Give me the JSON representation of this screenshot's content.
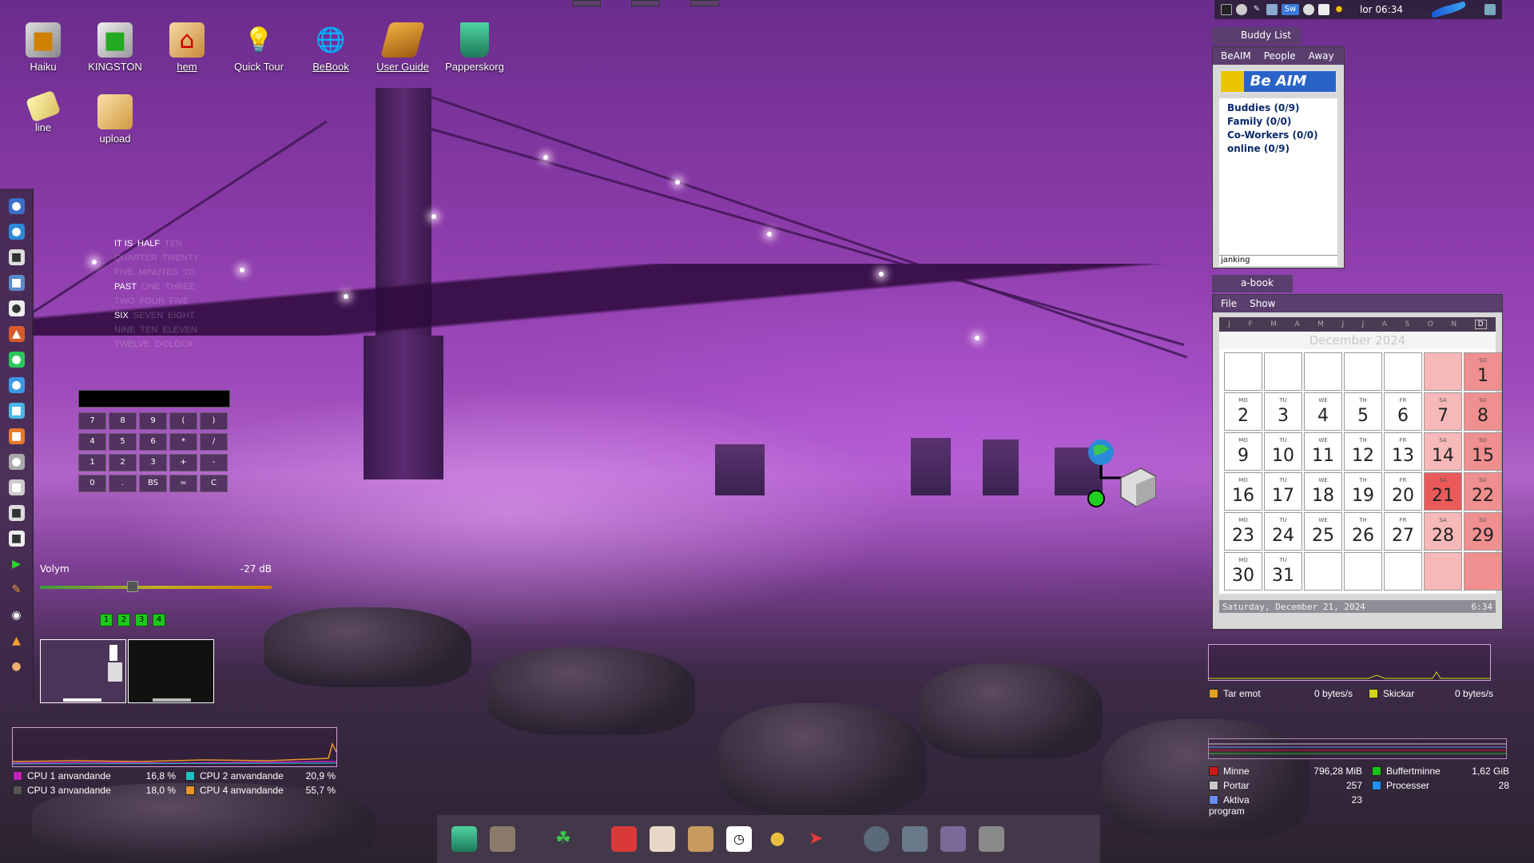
{
  "desktop_icons": [
    {
      "label": "Haiku",
      "icon": "haiku-drive-icon"
    },
    {
      "label": "KINGSTON",
      "icon": "usb-drive-icon"
    },
    {
      "label": "hem",
      "icon": "home-folder-icon"
    },
    {
      "label": "Quick Tour",
      "icon": "lightbulb-icon"
    },
    {
      "label": "BeBook",
      "icon": "globe-book-icon"
    },
    {
      "label": "User Guide",
      "icon": "book-icon"
    },
    {
      "label": "Papperskorg",
      "icon": "trash-icon"
    },
    {
      "label": "line",
      "icon": "document-icon"
    },
    {
      "label": "upload",
      "icon": "folder-icon"
    }
  ],
  "word_clock": {
    "rows": [
      [
        {
          "w": "IT IS",
          "on": true
        },
        {
          "w": "HALF",
          "on": true
        },
        {
          "w": "TEN",
          "on": false
        }
      ],
      [
        {
          "w": "QUARTER",
          "on": false
        },
        {
          "w": "TWENTY",
          "on": false
        }
      ],
      [
        {
          "w": "FIVE",
          "on": false
        },
        {
          "w": "MINUTES",
          "on": false
        },
        {
          "w": "TO",
          "on": false
        }
      ],
      [
        {
          "w": "PAST",
          "on": true
        },
        {
          "w": "ONE",
          "on": false
        },
        {
          "w": "THREE",
          "on": false
        }
      ],
      [
        {
          "w": "TWO",
          "on": false
        },
        {
          "w": "FOUR",
          "on": false
        },
        {
          "w": "FIVE",
          "on": false
        }
      ],
      [
        {
          "w": "SIX",
          "on": true
        },
        {
          "w": "SEVEN",
          "on": false
        },
        {
          "w": "EIGHT",
          "on": false
        }
      ],
      [
        {
          "w": "NINE",
          "on": false
        },
        {
          "w": "TEN",
          "on": false
        },
        {
          "w": "ELEVEN",
          "on": false
        }
      ],
      [
        {
          "w": "TWELVE",
          "on": false
        },
        {
          "w": "O'CLOCK",
          "on": false
        }
      ]
    ]
  },
  "calculator": {
    "display": "",
    "keys": [
      "7",
      "8",
      "9",
      "(",
      ")",
      "4",
      "5",
      "6",
      "*",
      "/",
      "1",
      "2",
      "3",
      "+",
      "-",
      "0",
      ".",
      "BS",
      "=",
      "C"
    ]
  },
  "volume": {
    "label": "Volym",
    "value": "-27 dB",
    "level": 0.4
  },
  "workspaces": [
    "1",
    "2",
    "3",
    "4"
  ],
  "cpu": {
    "items": [
      {
        "label": "CPU 1 anvandande",
        "value": "16,8 %",
        "color": "#c21fc2"
      },
      {
        "label": "CPU 2 anvandande",
        "value": "20,9 %",
        "color": "#1fc2c2"
      },
      {
        "label": "CPU 3 anvandande",
        "value": "18,0 %",
        "color": "#555555"
      },
      {
        "label": "CPU 4 anvandande",
        "value": "55,7 %",
        "color": "#e8962a"
      }
    ]
  },
  "topbar": {
    "clock": "lor 06:34",
    "sw_label": "Sw"
  },
  "buddy_list": {
    "title": "Buddy List",
    "menu": [
      "BeAIM",
      "People",
      "Away"
    ],
    "banner": "Be AIM",
    "groups": [
      "Buddies (0/9)",
      "Family (0/0)",
      "Co-Workers (0/0)",
      "online (0/9)"
    ],
    "status": "janking"
  },
  "abook": {
    "title": "a-book",
    "menu": [
      "File",
      "Show"
    ],
    "months": [
      "J",
      "F",
      "M",
      "A",
      "M",
      "J",
      "J",
      "A",
      "S",
      "O",
      "N",
      "D"
    ],
    "month_title": "December 2024",
    "weeks": [
      [
        {
          "d": "",
          "n": ""
        },
        {
          "d": "",
          "n": ""
        },
        {
          "d": "",
          "n": ""
        },
        {
          "d": "",
          "n": ""
        },
        {
          "d": "",
          "n": ""
        },
        {
          "d": "",
          "n": "",
          "t": "sat"
        },
        {
          "d": "SU",
          "n": "1",
          "t": "sun"
        }
      ],
      [
        {
          "d": "MO",
          "n": "2"
        },
        {
          "d": "TU",
          "n": "3"
        },
        {
          "d": "WE",
          "n": "4"
        },
        {
          "d": "TH",
          "n": "5"
        },
        {
          "d": "FR",
          "n": "6"
        },
        {
          "d": "SA",
          "n": "7",
          "t": "sat"
        },
        {
          "d": "SU",
          "n": "8",
          "t": "sun"
        }
      ],
      [
        {
          "d": "MO",
          "n": "9"
        },
        {
          "d": "TU",
          "n": "10"
        },
        {
          "d": "WE",
          "n": "11"
        },
        {
          "d": "TH",
          "n": "12"
        },
        {
          "d": "FR",
          "n": "13"
        },
        {
          "d": "SA",
          "n": "14",
          "t": "sat"
        },
        {
          "d": "SU",
          "n": "15",
          "t": "sun"
        }
      ],
      [
        {
          "d": "MO",
          "n": "16"
        },
        {
          "d": "TU",
          "n": "17"
        },
        {
          "d": "WE",
          "n": "18"
        },
        {
          "d": "TH",
          "n": "19"
        },
        {
          "d": "FR",
          "n": "20"
        },
        {
          "d": "SA",
          "n": "21",
          "t": "today"
        },
        {
          "d": "SU",
          "n": "22",
          "t": "sun"
        }
      ],
      [
        {
          "d": "MO",
          "n": "23"
        },
        {
          "d": "TU",
          "n": "24"
        },
        {
          "d": "WE",
          "n": "25"
        },
        {
          "d": "TH",
          "n": "26"
        },
        {
          "d": "FR",
          "n": "27"
        },
        {
          "d": "SA",
          "n": "28",
          "t": "sat"
        },
        {
          "d": "SU",
          "n": "29",
          "t": "sun"
        }
      ],
      [
        {
          "d": "MO",
          "n": "30"
        },
        {
          "d": "TU",
          "n": "31"
        },
        {
          "d": "",
          "n": ""
        },
        {
          "d": "",
          "n": ""
        },
        {
          "d": "",
          "n": ""
        },
        {
          "d": "",
          "n": "",
          "t": "sat"
        },
        {
          "d": "",
          "n": "",
          "t": "sun"
        }
      ]
    ],
    "date_text": "Saturday, December 21, 2024",
    "time_text": "6:34"
  },
  "network": {
    "items": [
      {
        "label": "Tar emot",
        "value": "0 bytes/s",
        "color": "#e0a020"
      },
      {
        "label": "Skickar",
        "value": "0 bytes/s",
        "color": "#d4d41c"
      }
    ]
  },
  "memory": {
    "items": [
      {
        "label": "Minne",
        "value": "796,28 MiB",
        "color": "#d01818"
      },
      {
        "label": "Buffertminne",
        "value": "1,62 GiB",
        "color": "#18c418"
      },
      {
        "label": "Portar",
        "value": "257",
        "color": "#c8c8c8"
      },
      {
        "label": "Processer",
        "value": "28",
        "color": "#1e90ff"
      },
      {
        "label": "Aktiva program",
        "value": "23",
        "color": "#6a8cf0"
      }
    ]
  },
  "dock_icons": [
    "trash-icon",
    "package-icon",
    "plant-icon",
    "gift-icon",
    "box-icon",
    "dog-icon",
    "clock-icon",
    "keys-icon",
    "rocket-icon",
    "paint-icon",
    "cube-icon",
    "eraser-icon",
    "tools-icon"
  ]
}
